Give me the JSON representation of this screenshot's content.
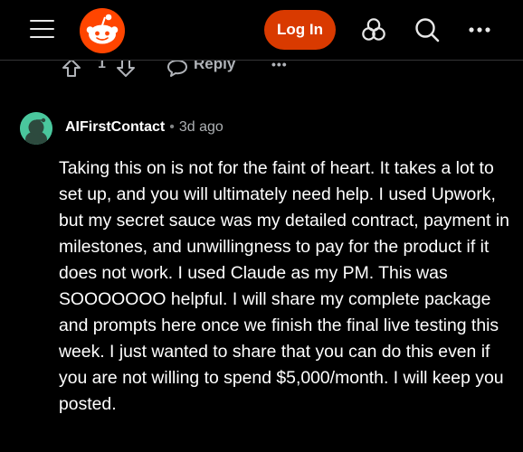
{
  "header": {
    "login_label": "Log In",
    "icons": [
      "menu-icon",
      "reddit-logo",
      "popular-icon",
      "search-icon",
      "more-icon"
    ],
    "accent_color": "#d93a00"
  },
  "previous_comment": {
    "vote_count": "1",
    "reply_label": "Reply",
    "more_label": "•••"
  },
  "comment": {
    "author": "AIFirstContact",
    "separator": "•",
    "time": "3d ago",
    "body": "Taking this on is not for the faint of heart. It takes a lot to set up, and you will ultimately need help. I used Upwork, but my secret sauce was my detailed contract, payment in milestones, and unwillingness to pay for the product if it does not work. I used Claude as my PM. This was SOOOOOOO helpful. I will share my complete package and prompts here once we finish the final live testing this week. I just wanted to share that you can do this even if you are not willing to spend $5,000/month. I will keep you posted."
  }
}
